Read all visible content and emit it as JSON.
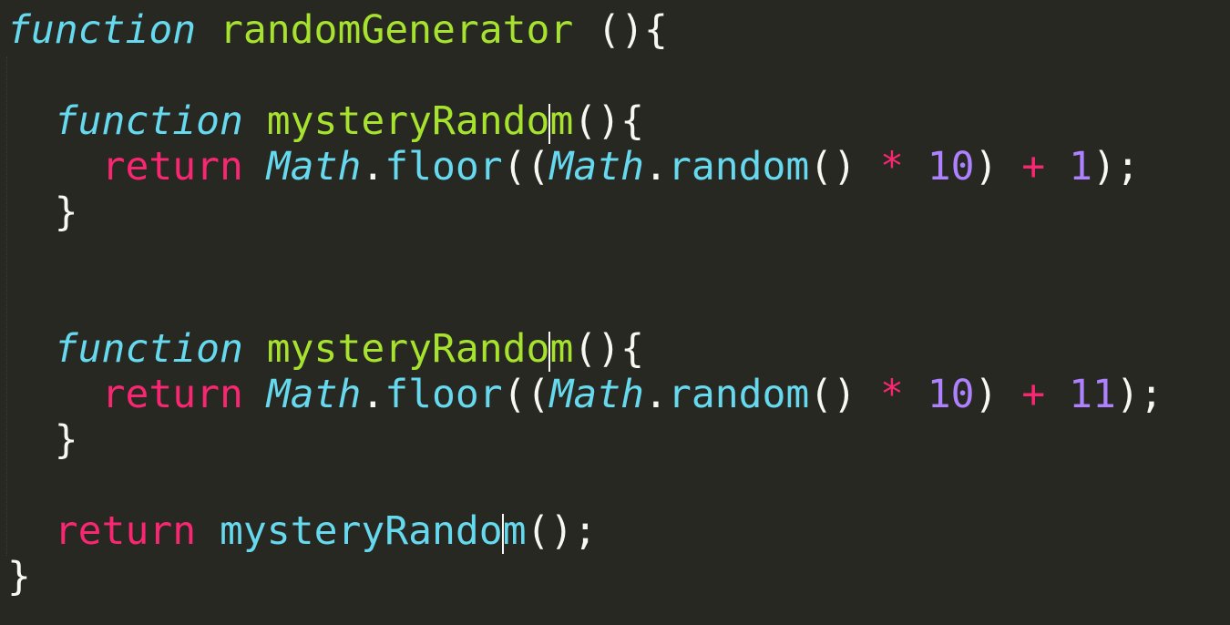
{
  "editor": {
    "theme_colors": {
      "background": "#272822",
      "keyword_function": "#66D9EF",
      "function_name": "#A6E22E",
      "keyword_return": "#F92672",
      "number": "#AE81FF",
      "text": "#F8F8F2"
    },
    "lines": [
      {
        "tokens": {
          "t1": "function",
          "t2": " ",
          "t3": "randomGenerator",
          "t4": " (){"
        }
      },
      {
        "tokens": {}
      },
      {
        "tokens": {
          "indent": "  ",
          "t1": "function",
          "t2": " ",
          "t3a": "mysteryRando",
          "t3b": "m",
          "t4": "(){"
        }
      },
      {
        "tokens": {
          "indent": "    ",
          "t1": "return",
          "t2": " ",
          "t3": "Math",
          "t4": ".",
          "t5": "floor",
          "t6": "((",
          "t7": "Math",
          "t8": ".",
          "t9": "random",
          "t10": "() ",
          "t11": "*",
          "t12": " ",
          "t13": "10",
          "t14": ") ",
          "t15": "+",
          "t16": " ",
          "t17": "1",
          "t18": ");"
        }
      },
      {
        "tokens": {
          "indent": "  ",
          "t1": "}"
        }
      },
      {
        "tokens": {}
      },
      {
        "tokens": {}
      },
      {
        "tokens": {
          "indent": "  ",
          "t1": "function",
          "t2": " ",
          "t3a": "mysteryRando",
          "t3b": "m",
          "t4": "(){"
        }
      },
      {
        "tokens": {
          "indent": "    ",
          "t1": "return",
          "t2": " ",
          "t3": "Math",
          "t4": ".",
          "t5": "floor",
          "t6": "((",
          "t7": "Math",
          "t8": ".",
          "t9": "random",
          "t10": "() ",
          "t11": "*",
          "t12": " ",
          "t13": "10",
          "t14": ") ",
          "t15": "+",
          "t16": " ",
          "t17": "11",
          "t18": ");"
        }
      },
      {
        "tokens": {
          "indent": "  ",
          "t1": "}"
        }
      },
      {
        "tokens": {}
      },
      {
        "tokens": {
          "indent": "  ",
          "t1": "return",
          "t2": " ",
          "t3a": "mysteryRando",
          "t3b": "m",
          "t4": "();"
        }
      },
      {
        "tokens": {
          "t1": "}"
        }
      }
    ]
  }
}
